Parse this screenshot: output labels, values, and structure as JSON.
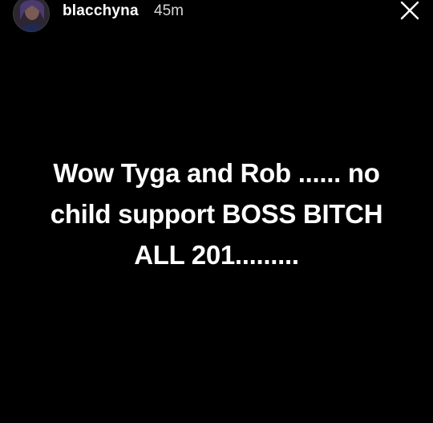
{
  "header": {
    "username": "blacchyna",
    "timestamp": "45m",
    "avatar_icon": "profile-avatar",
    "close_icon": "close-x-icon"
  },
  "caption": {
    "lines": [
      "Wow Tyga and Rob ...... no",
      "child support BOSS BITCH",
      "ALL 201........."
    ]
  },
  "colors": {
    "background": "#000000",
    "text": "#ffffff",
    "timestamp": "#d6d6d6"
  }
}
